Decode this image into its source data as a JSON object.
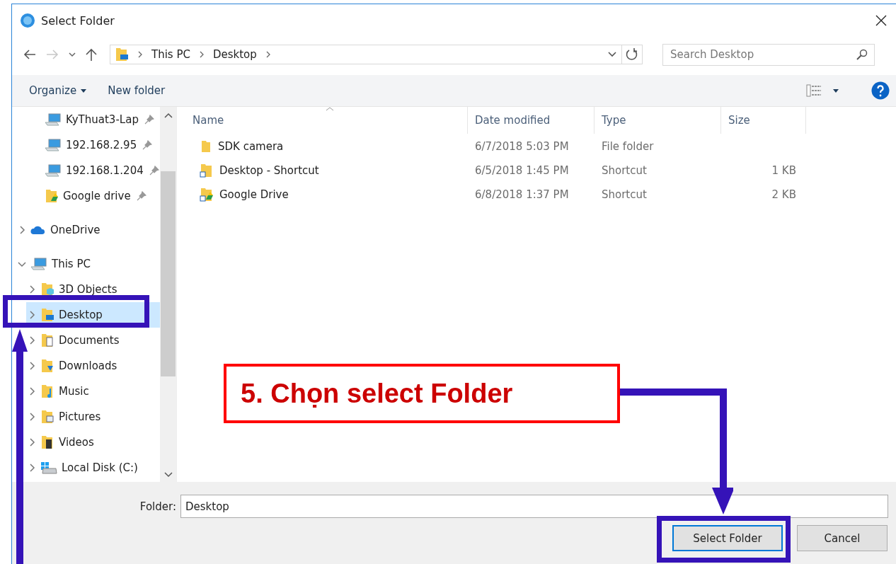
{
  "window": {
    "title": "Select Folder"
  },
  "address": {
    "crumbs": [
      "This PC",
      "Desktop"
    ]
  },
  "search": {
    "placeholder": "Search Desktop"
  },
  "toolbar": {
    "organize": "Organize",
    "new_folder": "New folder"
  },
  "quick_access": [
    {
      "label": "KyThuat3-Lap",
      "kind": "pc"
    },
    {
      "label": "192.168.2.95",
      "kind": "pc"
    },
    {
      "label": "192.168.1.204",
      "kind": "pc"
    },
    {
      "label": "Google drive",
      "kind": "gdrive"
    }
  ],
  "tree": [
    {
      "label": "OneDrive",
      "kind": "cloud",
      "expanded": false,
      "selected": false
    },
    {
      "label": "This PC",
      "kind": "pc",
      "expanded": true,
      "selected": false,
      "children": [
        {
          "label": "3D Objects",
          "kind": "objects",
          "expanded": false,
          "selected": false
        },
        {
          "label": "Desktop",
          "kind": "desktop",
          "expanded": false,
          "selected": true
        },
        {
          "label": "Documents",
          "kind": "documents",
          "expanded": false,
          "selected": false
        },
        {
          "label": "Downloads",
          "kind": "downloads",
          "expanded": false,
          "selected": false
        },
        {
          "label": "Music",
          "kind": "music",
          "expanded": false,
          "selected": false
        },
        {
          "label": "Pictures",
          "kind": "pictures",
          "expanded": false,
          "selected": false
        },
        {
          "label": "Videos",
          "kind": "videos",
          "expanded": false,
          "selected": false
        },
        {
          "label": "Local Disk (C:)",
          "kind": "disk",
          "expanded": false,
          "selected": false
        }
      ]
    }
  ],
  "table": {
    "columns": [
      "Name",
      "Date modified",
      "Type",
      "Size"
    ],
    "rows": [
      {
        "name": "SDK camera",
        "kind": "folder",
        "date": "6/7/2018 5:03 PM",
        "type": "File folder"
      },
      {
        "name": "Desktop - Shortcut",
        "kind": "shortcut",
        "date": "6/5/2018 1:45 PM",
        "type": "Shortcut",
        "size": "1 KB"
      },
      {
        "name": "Google Drive",
        "kind": "gshortcut",
        "date": "6/8/2018 1:37 PM",
        "type": "Shortcut",
        "size": "2 KB"
      }
    ]
  },
  "folder_field": {
    "label": "Folder:",
    "value": "Desktop"
  },
  "buttons": [
    "Select Folder",
    "Cancel"
  ],
  "callout": {
    "text": "5. Chọn select Folder"
  }
}
